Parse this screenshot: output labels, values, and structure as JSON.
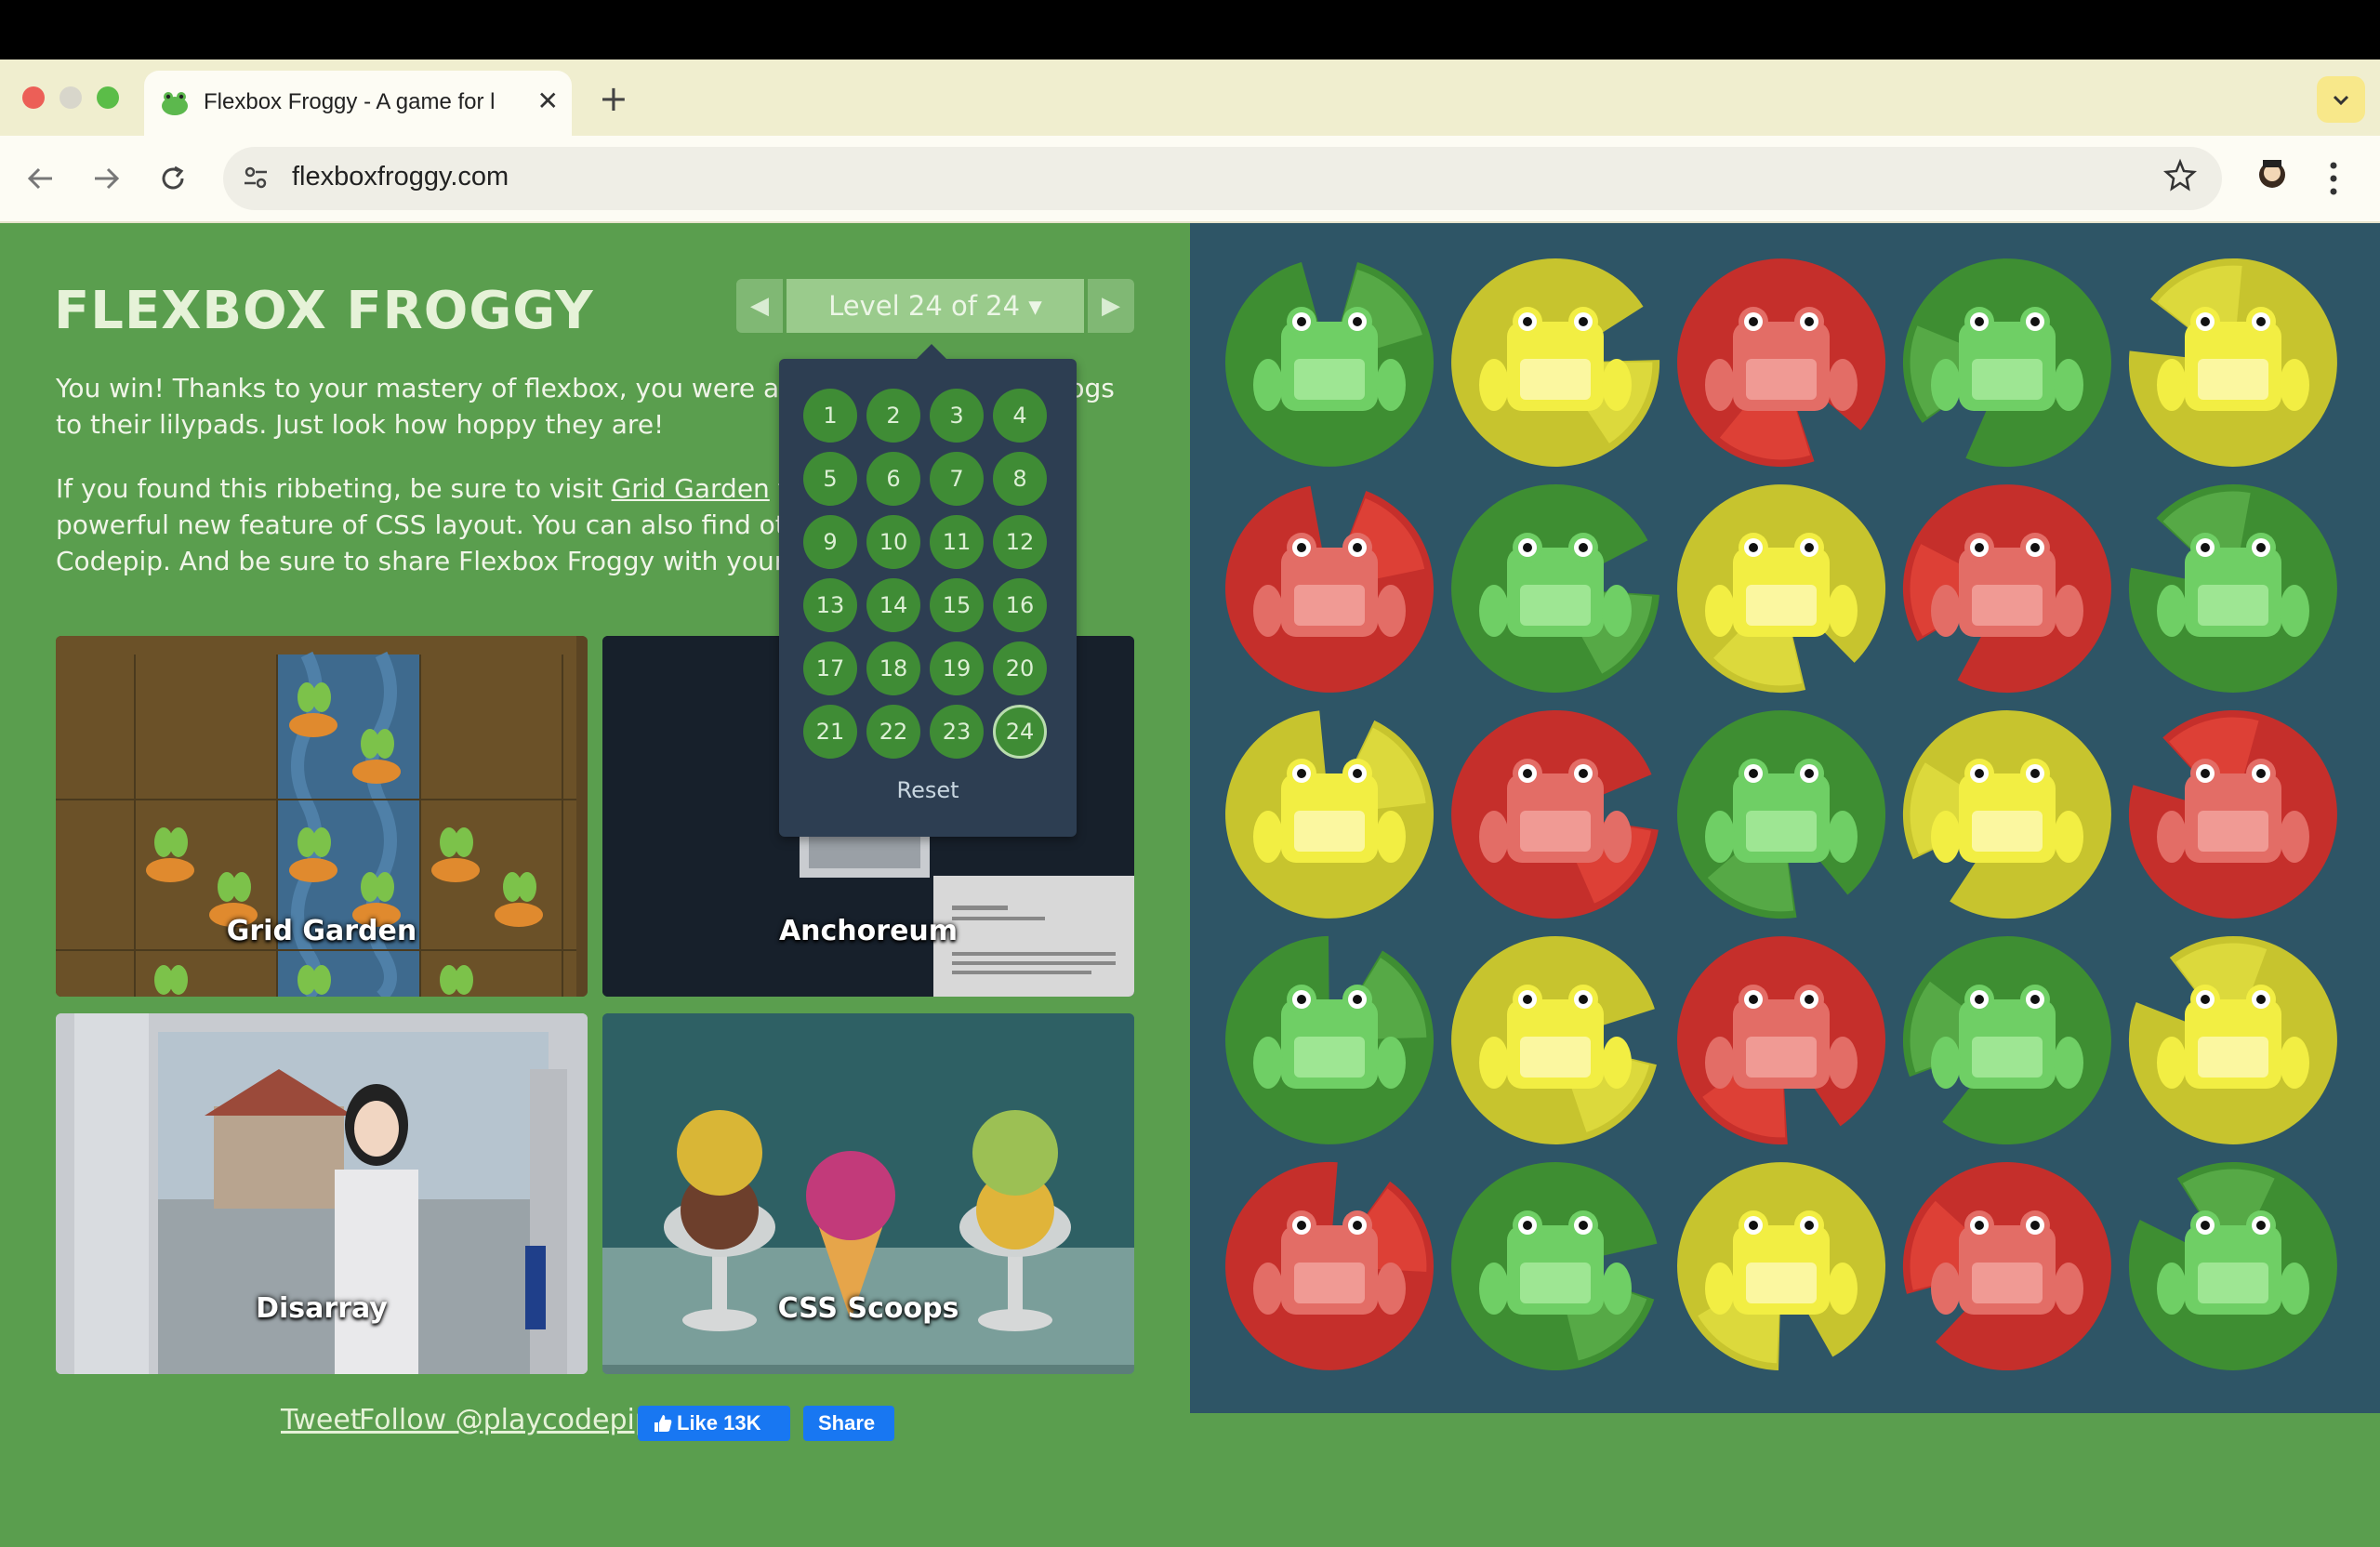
{
  "browser": {
    "tab_title": "Flexbox Froggy - A game for l",
    "tab_close": "✕",
    "new_tab": "+",
    "tab_menu_icon": "chevron-down-icon",
    "url": "flexboxfroggy.com",
    "traffic_light_colors": [
      "#ec5f57",
      "#d8d6cb",
      "#5bbd48"
    ]
  },
  "game": {
    "logo": "FLEXBOX FROGGY",
    "level_label": "Level 24 of 24 ▾",
    "prev_arrow": "◀",
    "next_arrow": "▶",
    "intro_p1": "You win! Thanks to your mastery of flexbox, you were able to help all of the frogs to their lilypads. Just look how hoppy they are!",
    "intro_p2_before": "If you found this ribbeting, be sure to visit ",
    "intro_p2_link": "Grid Garden",
    "intro_p2_after": " to learn about another powerful new feature of CSS layout. You can also find other coding games at Codepip. And be sure to share Flexbox Froggy with your friends!",
    "levels": [
      "1",
      "2",
      "3",
      "4",
      "5",
      "6",
      "7",
      "8",
      "9",
      "10",
      "11",
      "12",
      "13",
      "14",
      "15",
      "16",
      "17",
      "18",
      "19",
      "20",
      "21",
      "22",
      "23",
      "24"
    ],
    "current_level": "24",
    "reset_label": "Reset"
  },
  "games": [
    {
      "title": "Grid Garden"
    },
    {
      "title": "Anchoreum"
    },
    {
      "title": "Disarray"
    },
    {
      "title": "CSS Scoops"
    }
  ],
  "social": {
    "tweet": "Tweet",
    "follow": "Follow @playcodepip",
    "like": "Like 13K",
    "share": "Share"
  },
  "pond": {
    "rows": [
      [
        "green",
        "yellow",
        "red",
        "green",
        "yellow"
      ],
      [
        "red",
        "green",
        "yellow",
        "red",
        "green"
      ],
      [
        "yellow",
        "red",
        "green",
        "yellow",
        "red"
      ],
      [
        "green",
        "yellow",
        "red",
        "green",
        "yellow"
      ],
      [
        "red",
        "green",
        "yellow",
        "red",
        "green"
      ]
    ],
    "colors": {
      "green": {
        "pad": "#3e8e32",
        "pad_hi": "#56a946",
        "frog": "#6fcf65",
        "belly": "#9ee693"
      },
      "yellow": {
        "pad": "#c7c42e",
        "pad_hi": "#dcd93c",
        "frog": "#f2ee43",
        "belly": "#fbf7a0"
      },
      "red": {
        "pad": "#c52f2b",
        "pad_hi": "#dd4036",
        "frog": "#e36d66",
        "belly": "#f09a94"
      }
    }
  }
}
